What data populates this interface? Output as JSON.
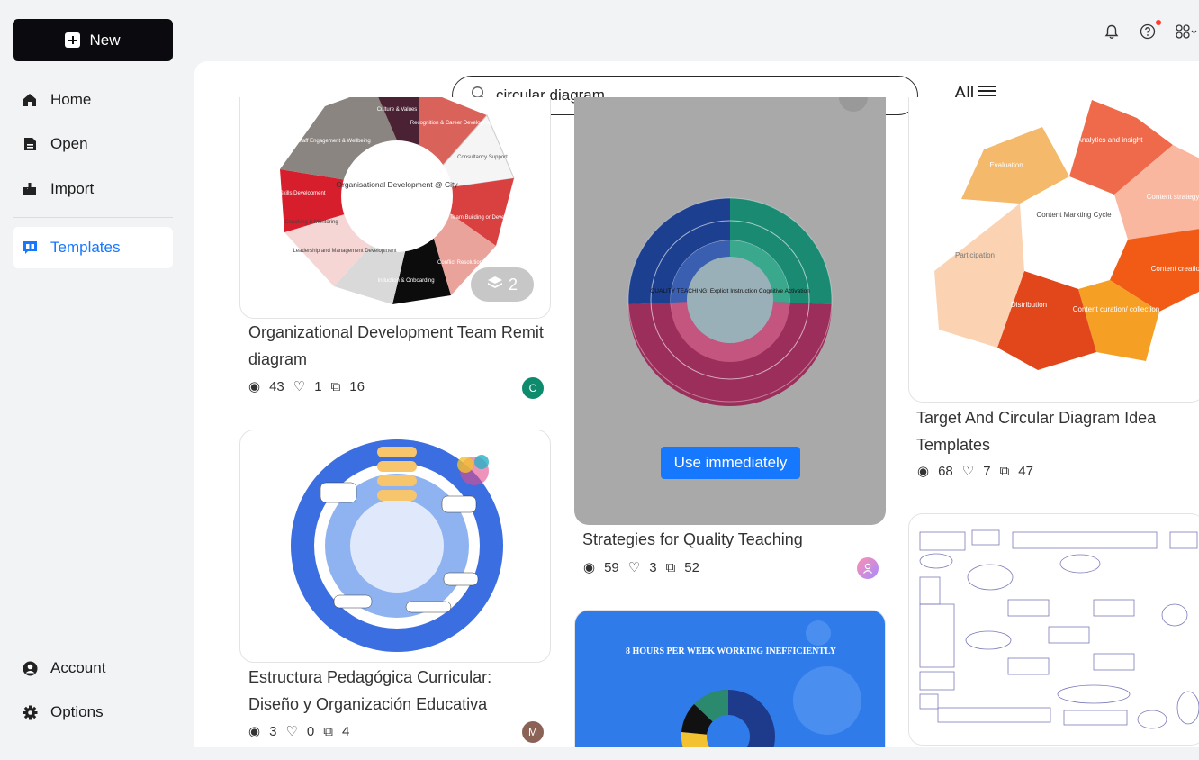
{
  "sidebar": {
    "new_label": "New",
    "items": [
      {
        "label": "Home",
        "icon": "home-icon"
      },
      {
        "label": "Open",
        "icon": "file-icon"
      },
      {
        "label": "Import",
        "icon": "import-icon"
      },
      {
        "label": "Templates",
        "icon": "templates-icon"
      },
      {
        "label": "Account",
        "icon": "account-icon"
      },
      {
        "label": "Options",
        "icon": "gear-icon"
      }
    ]
  },
  "search": {
    "value": "circular diagram"
  },
  "filter": {
    "label": "All"
  },
  "accent": "#1677ff",
  "cards": [
    {
      "title": "Organizational Development Team Remit diagram",
      "views": "43",
      "likes": "1",
      "copies": "16",
      "layers": "2",
      "avatar": "C",
      "avatar_color": "#0e8a6d",
      "diagram": {
        "center": "Organisational Development @ City",
        "segments": [
          "Culture & Values",
          "Recognition & Career Development",
          "Consultancy Support",
          "Team Building or Development",
          "Conflict Resolution",
          "Induction & Onboarding",
          "Leadership and Management Development",
          "Coaching & Mentoring",
          "Skills Development",
          "Staff Engagement & Wellbeing"
        ]
      }
    },
    {
      "title": "Strategies for Quality Teaching",
      "views": "59",
      "likes": "3",
      "copies": "52",
      "use_label": "Use immediately",
      "diagram": {
        "center": "QUALITY TEACHING: Explicit Instruction Cognitive Activation"
      }
    },
    {
      "title": "Target And Circular Diagram Idea Templates",
      "views": "68",
      "likes": "7",
      "copies": "47",
      "diagram": {
        "center": "Content Markting Cycle",
        "segments": [
          "Evaluation",
          "Analytics and insight",
          "Content strategy",
          "Content creation",
          "Content curation/ collection",
          "Distribution",
          "Participation"
        ]
      }
    },
    {
      "title": "Estructura Pedagógica Curricular: Diseño y Organización Educativa",
      "views": "3",
      "likes": "0",
      "copies": "4",
      "avatar": "M",
      "avatar_color": "#8a6356"
    },
    {
      "title": "",
      "diagram": {
        "heading": "8 HOURS PER WEEK WORKING INEFFICIENTLY"
      }
    }
  ]
}
